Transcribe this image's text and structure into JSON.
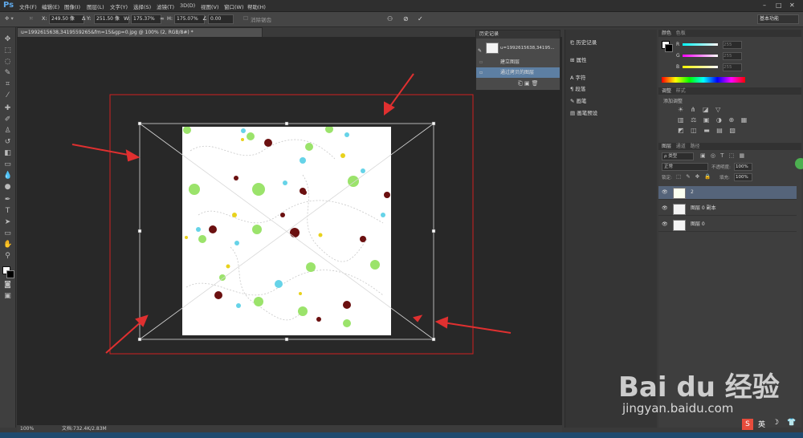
{
  "menubar": {
    "logo": "Ps",
    "items": [
      "文件(F)",
      "编辑(E)",
      "图像(I)",
      "图层(L)",
      "文字(Y)",
      "选择(S)",
      "滤镜(T)",
      "3D(D)",
      "视图(V)",
      "窗口(W)",
      "帮助(H)"
    ]
  },
  "options": {
    "x_label": "X:",
    "x_value": "249.50 像",
    "y_label": "Y:",
    "y_value": "251.50 像",
    "w_label": "W:",
    "w_value": "175.37%",
    "h_label": "H:",
    "h_value": "175.07%",
    "angle_value": "0.00",
    "interp_label": "消除锯齿",
    "workspace": "基本功能"
  },
  "document": {
    "tab_title": "u=1992615638,3419559265&fm=15&gp=0.jpg @ 100% (2, RGB/8#) *",
    "status_zoom": "100%",
    "status_doc": "文档:732.4K/2.83M"
  },
  "history": {
    "tab": "历史记录",
    "snapshot": "u=1992615638,34195...",
    "rows": [
      "建立图层",
      "通过拷贝的图层"
    ]
  },
  "dock": {
    "items": [
      "历史记录",
      "属性",
      "字符",
      "段落",
      "画笔",
      "画笔预设"
    ]
  },
  "color_panel": {
    "tabs": [
      "颜色",
      "色板"
    ],
    "channels": [
      "R",
      "G",
      "B"
    ],
    "values": [
      "255",
      "255",
      "255"
    ]
  },
  "adjust_panel": {
    "tabs": [
      "调整",
      "样式"
    ],
    "hint": "添加调整"
  },
  "layers_panel": {
    "tabs": [
      "图层",
      "通道",
      "路径"
    ],
    "kind": "ρ 类型",
    "blend": "正常",
    "opacity_label": "不透明度:",
    "opacity_value": "100%",
    "lock_label": "锁定:",
    "fill_label": "填充:",
    "fill_value": "100%",
    "layers": [
      "2",
      "图层 0 副本",
      "图层 0"
    ]
  },
  "watermark": {
    "brand": "Bai du 经验",
    "url": "jingyan.baidu.com"
  },
  "tray": {
    "ime": "英"
  }
}
